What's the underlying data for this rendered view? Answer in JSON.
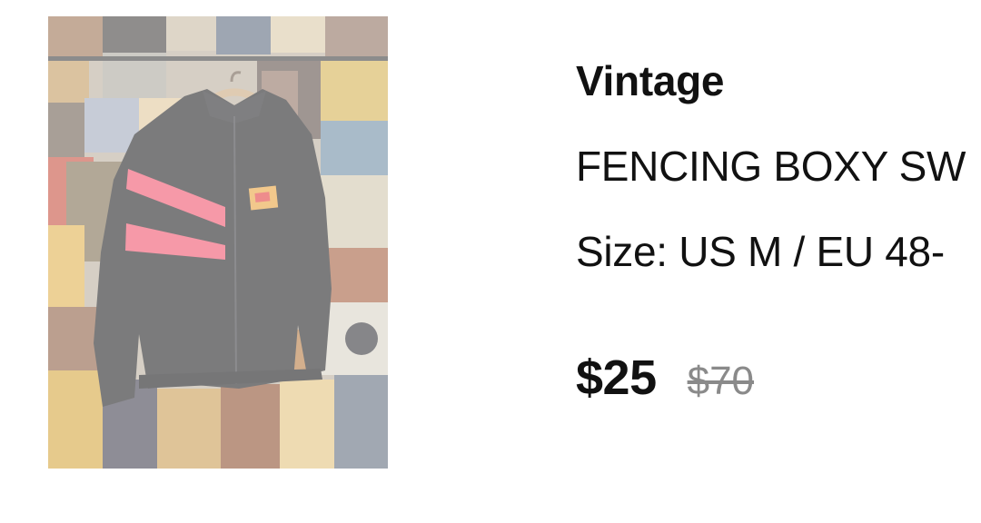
{
  "product": {
    "brand": "Vintage",
    "title": "FENCING BOXY SW",
    "size": "Size: US M / EU 48-",
    "price": "$25",
    "original_price": "$70",
    "image_alt": "black jacket with pink stripes on hanger"
  },
  "colors": {
    "text": "#111111",
    "muted": "#8a8a8a",
    "jacket": "#1c1c1e",
    "stripe": "#f0506a"
  }
}
